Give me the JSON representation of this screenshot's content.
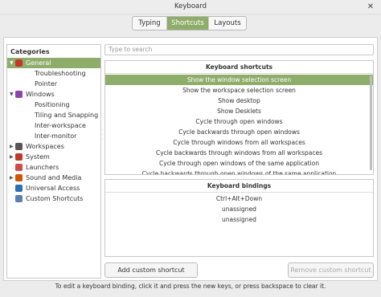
{
  "window": {
    "title": "Keyboard",
    "close_symbol": "✕"
  },
  "tabs": [
    {
      "label": "Typing",
      "active": false
    },
    {
      "label": "Shortcuts",
      "active": true
    },
    {
      "label": "Layouts",
      "active": false
    }
  ],
  "categories": {
    "heading": "Categories",
    "items": [
      {
        "label": "General",
        "arrow": "▼",
        "icon": "general-icon",
        "color": "#c0392b",
        "selected": true
      },
      {
        "label": "Troubleshooting",
        "child": true
      },
      {
        "label": "Pointer",
        "child": true
      },
      {
        "label": "Windows",
        "arrow": "▼",
        "icon": "windows-icon",
        "color": "#8e44ad"
      },
      {
        "label": "Positioning",
        "child": true
      },
      {
        "label": "Tiling and Snapping",
        "child": true
      },
      {
        "label": "Inter-workspace",
        "child": true
      },
      {
        "label": "Inter-monitor",
        "child": true
      },
      {
        "label": "Workspaces",
        "arrow": "▶",
        "icon": "workspaces-icon",
        "color": "#555555"
      },
      {
        "label": "System",
        "arrow": "▶",
        "icon": "system-icon",
        "color": "#c0392b"
      },
      {
        "label": "Launchers",
        "icon": "launchers-icon",
        "color": "#d04a4a"
      },
      {
        "label": "Sound and Media",
        "arrow": "▶",
        "icon": "sound-icon",
        "color": "#d35400"
      },
      {
        "label": "Universal Access",
        "icon": "accessibility-icon",
        "color": "#2c6fb5"
      },
      {
        "label": "Custom Shortcuts",
        "icon": "custom-icon",
        "color": "#5b7fb0"
      }
    ]
  },
  "search": {
    "placeholder": "Type to search"
  },
  "shortcuts": {
    "heading": "Keyboard shortcuts",
    "items": [
      "Show the window selection screen",
      "Show the workspace selection screen",
      "Show desktop",
      "Show Desklets",
      "Cycle through open windows",
      "Cycle backwards through open windows",
      "Cycle through windows from all workspaces",
      "Cycle backwards through windows from all workspaces",
      "Cycle through open windows of the same application",
      "Cycle backwards through open windows of the same application"
    ],
    "selected_index": 0
  },
  "bindings": {
    "heading": "Keyboard bindings",
    "items": [
      "Ctrl+Alt+Down",
      "unassigned",
      "unassigned"
    ]
  },
  "buttons": {
    "add": "Add custom shortcut",
    "remove": "Remove custom shortcut"
  },
  "footer": "To edit a keyboard binding, click it and press the new keys, or press backspace to clear it.",
  "colors": {
    "accent": "#8fad6a"
  }
}
